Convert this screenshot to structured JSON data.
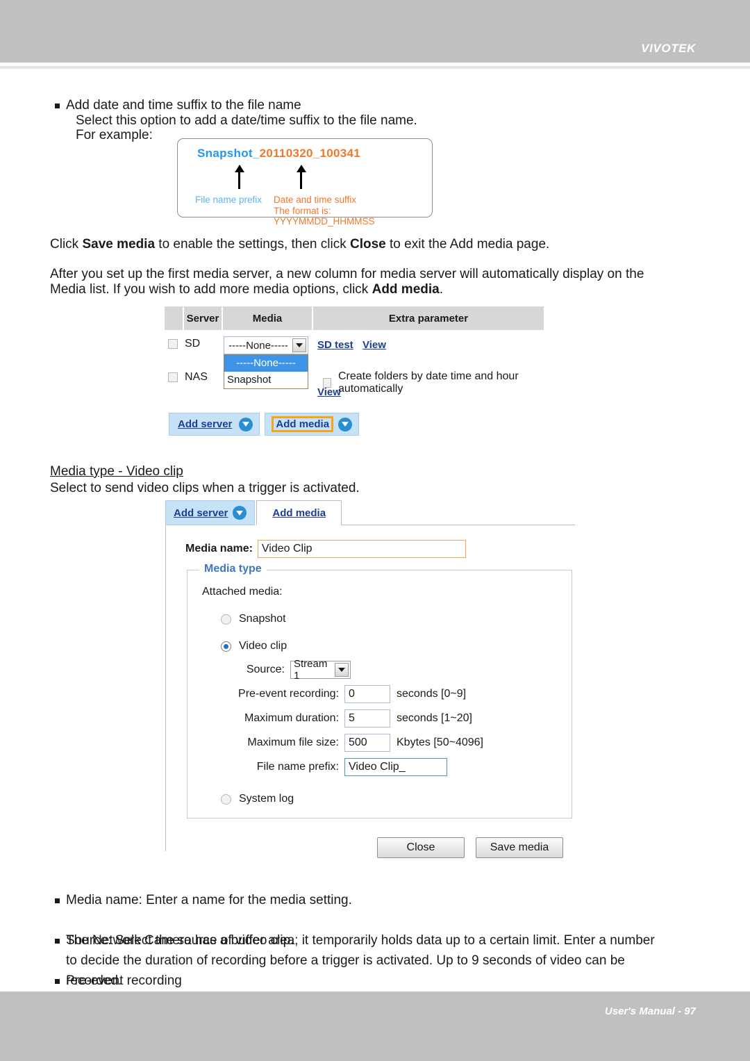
{
  "header": {
    "brand": "VIVOTEK"
  },
  "footer": {
    "text": "User's Manual - 97"
  },
  "doc": {
    "bullet1_title": "Add date and time suffix to the file name",
    "bullet1_line1": "Select this option to add a date/time suffix to the file name.",
    "bullet1_line2": "For example:",
    "para_click_pre": "Click ",
    "para_click_b1": "Save media",
    "para_click_mid": " to enable the settings, then click ",
    "para_click_b2": "Close",
    "para_click_end": " to exit the Add media page.",
    "para_after_1": "After you set up the first media server, a new column for media server will automatically display on the",
    "para_after_2_pre": "Media list. If you wish to add more media options, click ",
    "para_after_2_b": "Add media",
    "para_after_2_end": ".",
    "section_head": "Media type - Video clip",
    "section_sub": "Select to send video clips when a trigger is activated.",
    "bullet_media_name": "Media name: Enter a name for the media setting.",
    "bullet_source": "Source: Select the source of video clip.",
    "bullet_preevent": "Pre-event recording",
    "preevent_p1": "The Network Camera has a buffer area; it temporarily holds data up to a certain limit. Enter a number",
    "preevent_p2": "to decide the duration of recording before a trigger is activated. Up to 9 seconds of video can be",
    "preevent_p3": "recorded."
  },
  "snapshot_example": {
    "name_prefix": "Snapshot_",
    "name_suffix": "20110320_100341",
    "label_prefix": "File name prefix",
    "label_suffix": "Date and time suffix",
    "label_format": "The format is: YYYYMMDD_HHMMSS",
    "color_prefix": "#5ab6ef",
    "color_suffix": "#f0782a"
  },
  "media_table": {
    "columns": [
      "",
      "Server",
      "Media",
      "Extra parameter"
    ],
    "rows": [
      {
        "name": "SD",
        "media_value": "-----None-----",
        "links": [
          "SD test",
          "View"
        ]
      },
      {
        "name": "NAS",
        "media_value": "-----None-----",
        "checkbox_label": "Create folders by date time and hour automatically",
        "links": [
          "View"
        ]
      }
    ],
    "dropdown_options": [
      "-----None-----",
      "Snapshot"
    ],
    "dropdown_selected": "-----None-----",
    "buttons": {
      "add_server": "Add server",
      "add_media": "Add media"
    }
  },
  "media_panel": {
    "tab_add_server": "Add server",
    "tab_add_media": "Add media",
    "media_name_label": "Media name:",
    "media_name_value": "Video Clip",
    "fieldset_legend": "Media type",
    "attached_media_label": "Attached media:",
    "radio_snapshot": "Snapshot",
    "radio_video_clip": "Video clip",
    "radio_system_log": "System log",
    "source_label": "Source:",
    "source_value": "Stream 1",
    "preevent_label": "Pre-event recording:",
    "preevent_value": "0",
    "preevent_unit": "seconds [0~9]",
    "maxdur_label": "Maximum duration:",
    "maxdur_value": "5",
    "maxdur_unit": "seconds [1~20]",
    "maxsize_label": "Maximum file size:",
    "maxsize_value": "500",
    "maxsize_unit": "Kbytes [50~4096]",
    "prefix_label": "File name prefix:",
    "prefix_value": "Video Clip_",
    "btn_close": "Close",
    "btn_save": "Save media"
  }
}
